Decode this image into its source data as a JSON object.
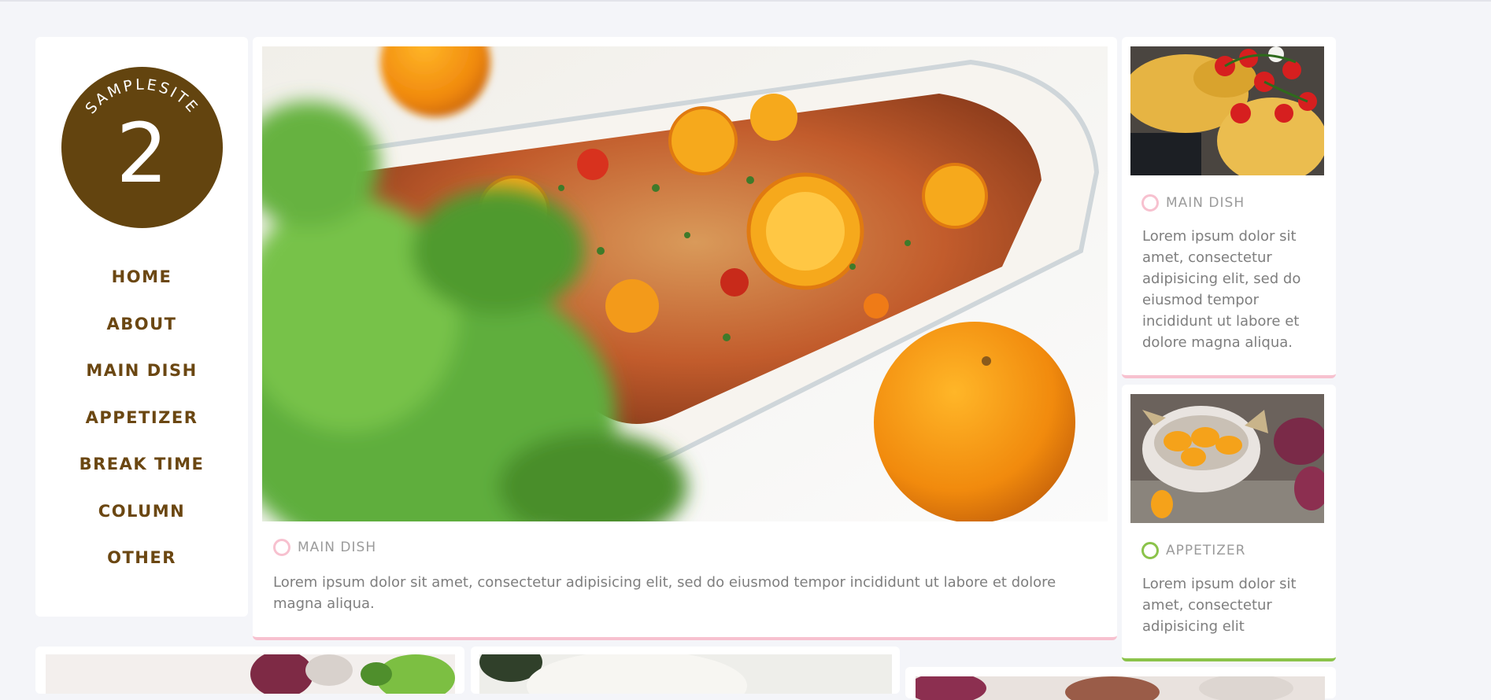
{
  "site": {
    "logo_text": "SAMPLESITE",
    "logo_number": "2"
  },
  "nav": {
    "items": [
      {
        "label": "HOME"
      },
      {
        "label": "ABOUT"
      },
      {
        "label": "MAIN DISH"
      },
      {
        "label": "APPETIZER"
      },
      {
        "label": "BREAK TIME"
      },
      {
        "label": "COLUMN"
      },
      {
        "label": "OTHER"
      }
    ]
  },
  "featured": {
    "category": "MAIN DISH",
    "excerpt": "Lorem ipsum dolor sit amet, consectetur adipisicing elit, sed do eiusmod tempor incididunt ut labore et dolore magna aliqua.",
    "accent": "#f7c1cf"
  },
  "side_posts": [
    {
      "category": "MAIN DISH",
      "excerpt": "Lorem ipsum dolor sit amet, consectetur adipisicing elit, sed do eiusmod tempor incididunt ut labore et dolore magna aliqua.",
      "accent": "#f7c1cf"
    },
    {
      "category": "APPETIZER",
      "excerpt": "Lorem ipsum dolor sit amet, consectetur adipisicing elit",
      "accent": "#8bc34a"
    }
  ],
  "colors": {
    "brand": "#63440f",
    "nav_text": "#6b4712",
    "background": "#f4f5f9",
    "card": "#ffffff",
    "muted_text": "#7e7e7e",
    "main_dish_accent": "#f7c1cf",
    "appetizer_accent": "#8bc34a"
  },
  "icons": {
    "category_marker": "ring-icon"
  }
}
